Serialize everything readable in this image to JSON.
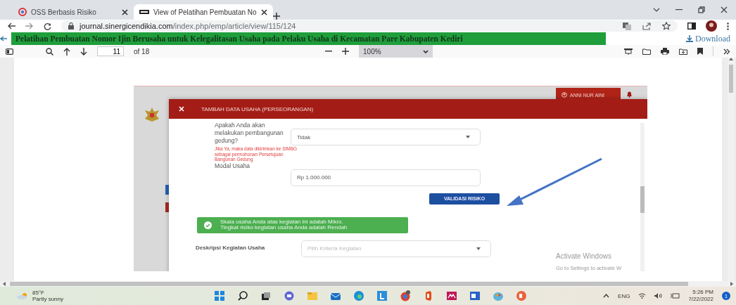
{
  "browser": {
    "tabs": [
      {
        "title": "OSS Berbasis Risiko",
        "selected": false
      },
      {
        "title": "View of Pelatihan Pembuatan No",
        "selected": true
      }
    ],
    "url_domain": "journal.sinergicendikia.com",
    "url_path": "/index.php/emp/article/view/115/124"
  },
  "article_bar": {
    "title": "Pelatihan Pembuatan Nomor Ijin Berusaha untuk Kelegalitasan Usaha pada Pelaku Usaha di Kecamatan Pare Kabupaten Kediri",
    "download": "Download"
  },
  "pdf_toolbar": {
    "page": "11",
    "page_total": "of 18",
    "zoom": "100%"
  },
  "embedded": {
    "user_button": "ANNI NUR AINI",
    "dialog": {
      "title": "TAMBAH DATA USAHA (PERSEORANGAN)",
      "fields": [
        {
          "kind": "select",
          "label": "Apakah Anda akan melakukan pembangunan gedung?",
          "note": "Jika Ya, maka data dikirimkan ke SIMBG sebagai permohonan Persetujuan Bangunan Gedung",
          "value": "Tidak"
        },
        {
          "kind": "input",
          "label": "Modal Usaha",
          "value": "Rp 1.000.000"
        }
      ],
      "button": "VALIDASI RISIKO",
      "alert": [
        "Skala usaha Anda atas kegiatan ini adalah Mikro.",
        "Tingkat risiko kegiatan usaha Anda adalah Rendah"
      ],
      "last_field": {
        "kind": "select",
        "label": "Deskripsi Kegiatan Usaha",
        "placeholder": "Pilih Kriteria Kegiatan"
      }
    }
  },
  "activation": {
    "title": "Activate Windows",
    "text": "Go to Settings to activate W"
  },
  "taskbar": {
    "weather_temp": "85°F",
    "weather_text": "Partly sunny",
    "language": "ENG",
    "time": "5:26 PM",
    "date": "7/22/2022",
    "notifications": "1"
  }
}
